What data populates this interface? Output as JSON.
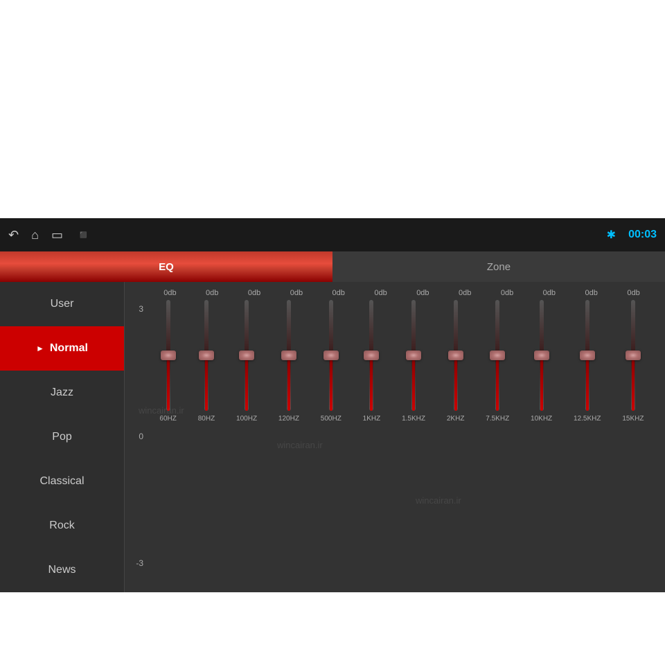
{
  "topbar": {
    "time": "00:03",
    "icons": [
      "back-icon",
      "home-icon",
      "window-icon",
      "image-icon"
    ]
  },
  "tabs": [
    {
      "id": "eq",
      "label": "EQ",
      "active": true
    },
    {
      "id": "zone",
      "label": "Zone",
      "active": false
    }
  ],
  "sidebar": {
    "items": [
      {
        "id": "user",
        "label": "User",
        "active": false
      },
      {
        "id": "normal",
        "label": "Normal",
        "active": true
      },
      {
        "id": "jazz",
        "label": "Jazz",
        "active": false
      },
      {
        "id": "pop",
        "label": "Pop",
        "active": false
      },
      {
        "id": "classical",
        "label": "Classical",
        "active": false
      },
      {
        "id": "rock",
        "label": "Rock",
        "active": false
      },
      {
        "id": "news",
        "label": "News",
        "active": false
      }
    ]
  },
  "eq": {
    "y_labels": [
      "3",
      "0",
      "-3"
    ],
    "bands": [
      {
        "freq": "60HZ",
        "db": "0db",
        "value": 0
      },
      {
        "freq": "80HZ",
        "db": "0db",
        "value": 0
      },
      {
        "freq": "100HZ",
        "db": "0db",
        "value": 0
      },
      {
        "freq": "120HZ",
        "db": "0db",
        "value": 0
      },
      {
        "freq": "500HZ",
        "db": "0db",
        "value": 0
      },
      {
        "freq": "1KHZ",
        "db": "0db",
        "value": 0
      },
      {
        "freq": "1.5KHZ",
        "db": "0db",
        "value": 0
      },
      {
        "freq": "2KHZ",
        "db": "0db",
        "value": 0
      },
      {
        "freq": "7.5KHZ",
        "db": "0db",
        "value": 0
      },
      {
        "freq": "10KHZ",
        "db": "0db",
        "value": 0
      },
      {
        "freq": "12.5KHZ",
        "db": "0db",
        "value": 0
      },
      {
        "freq": "15KHZ",
        "db": "0db",
        "value": 0
      }
    ]
  },
  "colors": {
    "accent_red": "#cc0000",
    "accent_blue": "#00bfff",
    "bg_dark": "#2a2a2a",
    "bg_darker": "#1a1a1a"
  }
}
